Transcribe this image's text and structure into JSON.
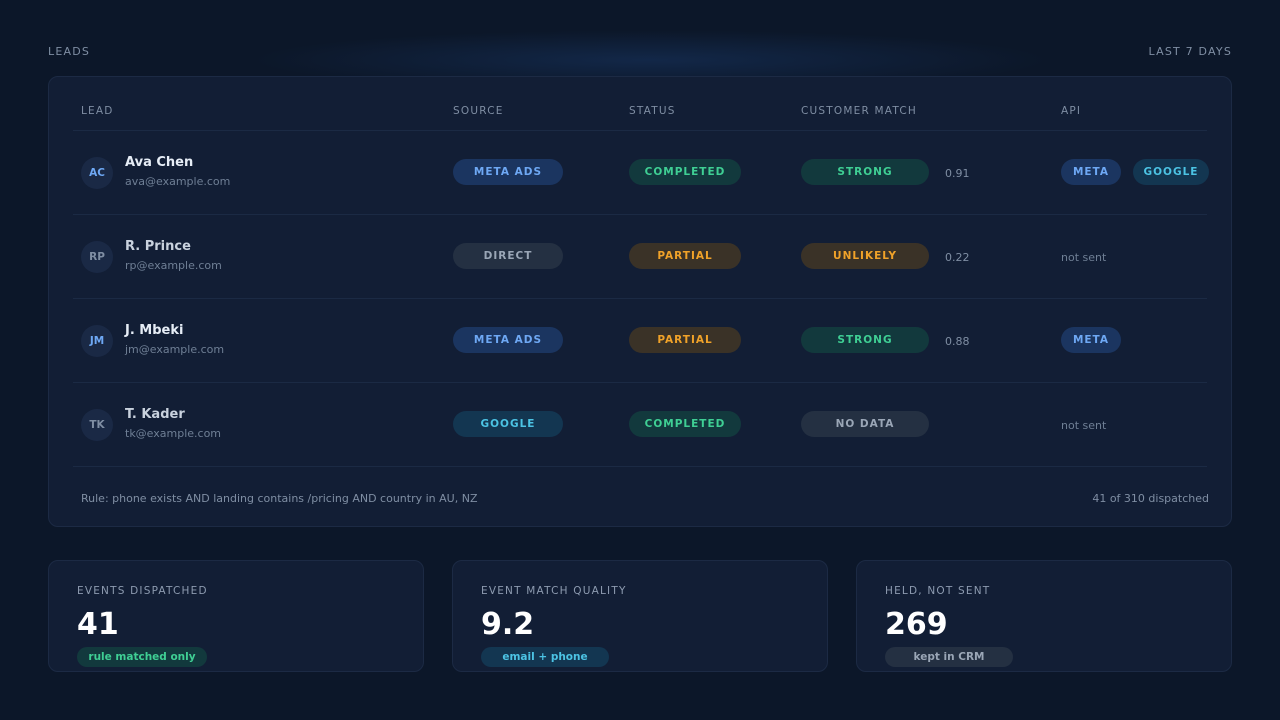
{
  "header": {
    "title": "LEADS",
    "range": "LAST 7 DAYS"
  },
  "table": {
    "columns": {
      "lead": "LEAD",
      "source": "SOURCE",
      "status": "STATUS",
      "match": "CUSTOMER MATCH",
      "api": "API"
    },
    "rows": [
      {
        "initials": "AC",
        "name": "Ava Chen",
        "email": "ava@example.com",
        "source": "META ADS",
        "status": "COMPLETED",
        "match": "STRONG",
        "score": "0.91",
        "api": [
          "META",
          "GOOGLE"
        ]
      },
      {
        "initials": "RP",
        "name": "R. Prince",
        "email": "rp@example.com",
        "source": "DIRECT",
        "status": "PARTIAL",
        "match": "UNLIKELY",
        "score": "0.22",
        "api_text": "not sent"
      },
      {
        "initials": "JM",
        "name": "J. Mbeki",
        "email": "jm@example.com",
        "source": "META ADS",
        "status": "PARTIAL",
        "match": "STRONG",
        "score": "0.88",
        "api": [
          "META"
        ]
      },
      {
        "initials": "TK",
        "name": "T. Kader",
        "email": "tk@example.com",
        "source": "GOOGLE",
        "status": "COMPLETED",
        "match": "NO DATA",
        "api_text": "not sent"
      }
    ],
    "footer": {
      "rule": "Rule: phone exists AND landing contains /pricing AND country in AU, NZ",
      "count": "41 of 310 dispatched"
    }
  },
  "stats": [
    {
      "label": "EVENTS DISPATCHED",
      "value": "41",
      "badge": "rule matched only"
    },
    {
      "label": "EVENT MATCH QUALITY",
      "value": "9.2",
      "badge": "email + phone"
    },
    {
      "label": "HELD, NOT SENT",
      "value": "269",
      "badge": "kept in CRM"
    }
  ],
  "colors": {
    "background": "#0c1729",
    "card": "#121e35",
    "blue": "#6ea8f4",
    "cyan": "#4cc3e4",
    "green": "#3fcf94",
    "amber": "#f0a229",
    "grey": "#9aa6b6"
  }
}
